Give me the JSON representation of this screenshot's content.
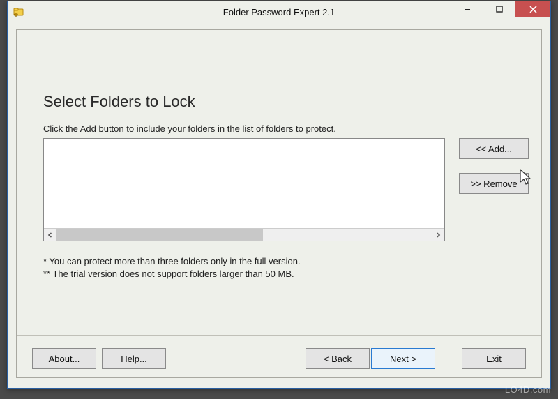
{
  "window": {
    "title": "Folder Password Expert 2.1"
  },
  "header": {
    "heading": "Select Folders to Lock",
    "instruction": "Click the Add button to include your folders in the list of folders to protect."
  },
  "side_buttons": {
    "add": "<<   Add...",
    "remove": ">>  Remove"
  },
  "notes": {
    "n1": "*  You can protect more than three folders only in the full version.",
    "n2": "** The trial version does not support folders larger than 50 MB."
  },
  "buttons": {
    "about": "About...",
    "help": "Help...",
    "back": "< Back",
    "next": "Next >",
    "exit": "Exit"
  },
  "watermark": "LO4D.com",
  "icons": {
    "app": "folder-lock-icon",
    "minimize": "minimize-icon",
    "maximize": "maximize-icon",
    "close": "close-icon",
    "cursor": "cursor-icon"
  }
}
